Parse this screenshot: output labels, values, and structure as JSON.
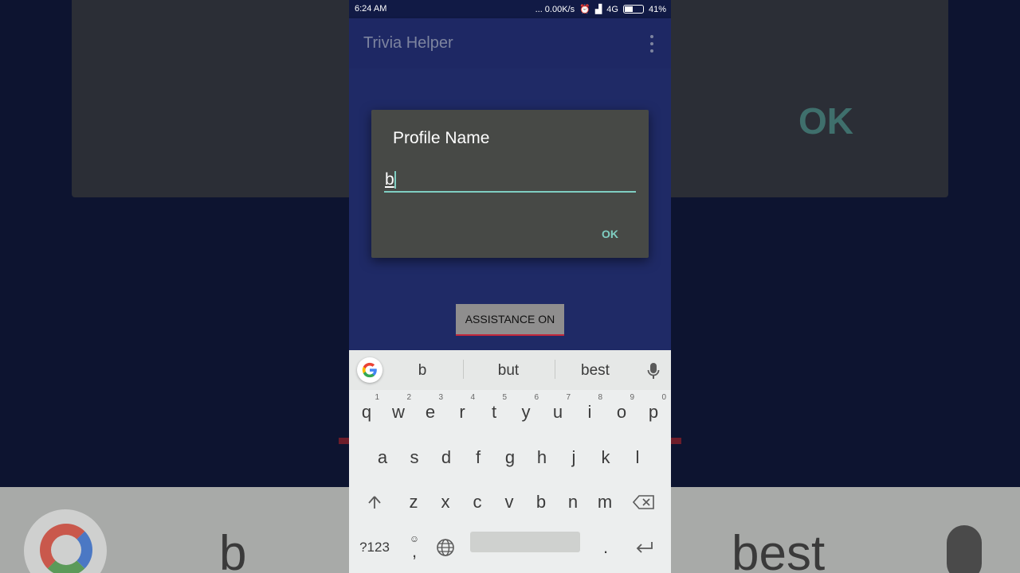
{
  "background": {
    "ok_label": "OK",
    "suggestion_left": "b",
    "suggestion_right": "best"
  },
  "status_bar": {
    "time": "6:24 AM",
    "speed": "... 0.00K/s",
    "network": "4G",
    "battery": "41%"
  },
  "app_bar": {
    "title": "Trivia Helper",
    "menu_icon": "more-vert-icon"
  },
  "dialog": {
    "title": "Profile Name",
    "input_value": "b",
    "ok_label": "OK"
  },
  "main": {
    "assistance_button_label": "ASSISTANCE ON"
  },
  "keyboard": {
    "suggestions": [
      "b",
      "but",
      "best"
    ],
    "row1": [
      {
        "k": "q",
        "n": "1"
      },
      {
        "k": "w",
        "n": "2"
      },
      {
        "k": "e",
        "n": "3"
      },
      {
        "k": "r",
        "n": "4"
      },
      {
        "k": "t",
        "n": "5"
      },
      {
        "k": "y",
        "n": "6"
      },
      {
        "k": "u",
        "n": "7"
      },
      {
        "k": "i",
        "n": "8"
      },
      {
        "k": "o",
        "n": "9"
      },
      {
        "k": "p",
        "n": "0"
      }
    ],
    "row2": [
      "a",
      "s",
      "d",
      "f",
      "g",
      "h",
      "j",
      "k",
      "l"
    ],
    "row3": [
      "z",
      "x",
      "c",
      "v",
      "b",
      "n",
      "m"
    ],
    "symbols_label": "?123",
    "comma_label": ",",
    "period_label": ".",
    "icons": [
      "google-icon",
      "mic-icon",
      "shift-icon",
      "backspace-icon",
      "emoji-icon",
      "globe-icon",
      "enter-icon"
    ]
  },
  "colors": {
    "accent": "#7fcec2",
    "app_bg": "#1f2a66",
    "dialog_bg": "#474946",
    "button_underline": "#c2273b"
  }
}
